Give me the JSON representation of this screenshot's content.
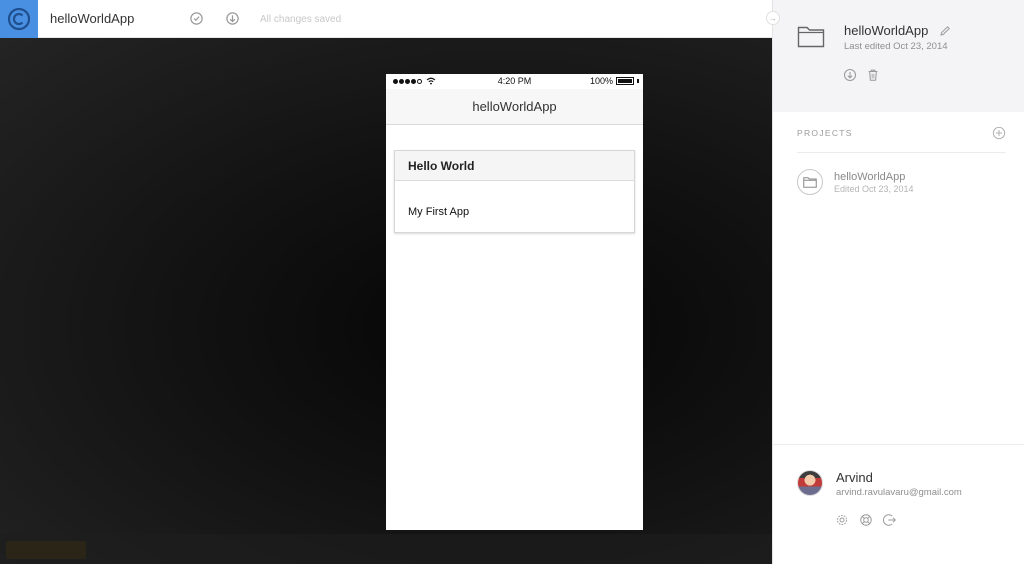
{
  "topbar": {
    "title": "helloWorldApp",
    "status": "All changes saved",
    "icons": [
      "logo-icon",
      "sync-icon",
      "download-icon"
    ]
  },
  "phone": {
    "status_time": "4:20 PM",
    "battery": "100%",
    "nav_title": "helloWorldApp",
    "card": {
      "header": "Hello World",
      "body": "My First App"
    }
  },
  "panel": {
    "project": {
      "name": "helloWorldApp",
      "edited": "Last edited Oct 23, 2014"
    },
    "projects_label": "PROJECTS",
    "projects": [
      {
        "name": "helloWorldApp",
        "edited": "Edited Oct 23, 2014"
      }
    ],
    "user": {
      "name": "Arvind",
      "email": "arvind.ravulavaru@gmail.com"
    }
  },
  "colors": {
    "accent": "#4a90e2",
    "canvas": "#141414",
    "panel_top": "#f4f4f6"
  }
}
